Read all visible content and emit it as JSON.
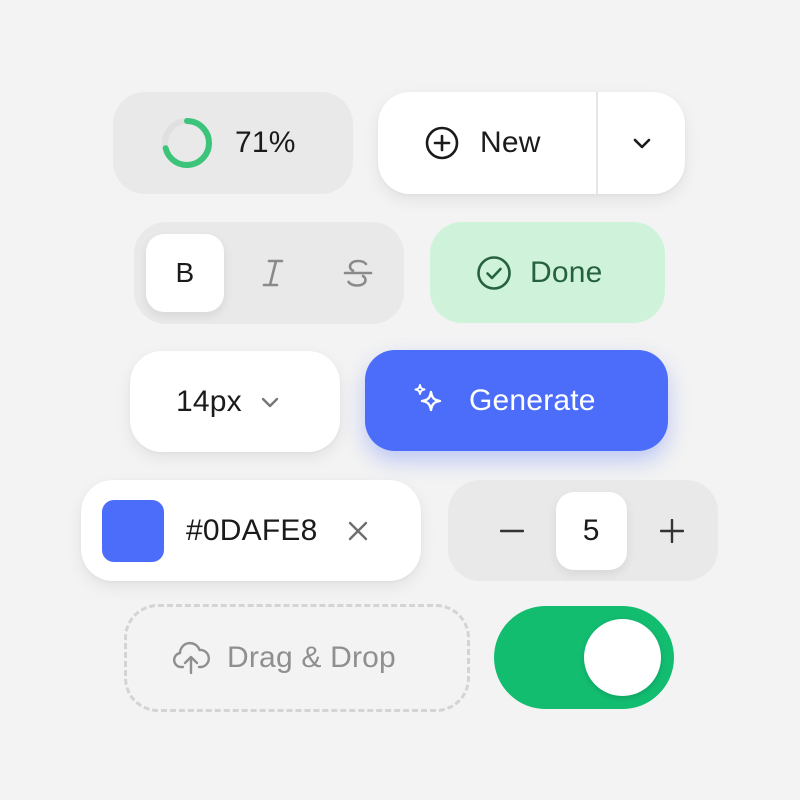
{
  "progress": {
    "value_percent": 71,
    "label": "71%",
    "track_color": "#e4e4e4",
    "fill_color": "#3cc57a"
  },
  "new_button": {
    "label": "New",
    "icon": "plus-circle-icon",
    "dropdown_icon": "chevron-down-icon"
  },
  "format_group": {
    "buttons": [
      {
        "label": "B",
        "icon": "bold-icon",
        "active": true
      },
      {
        "label": "I",
        "icon": "italic-icon",
        "active": false
      },
      {
        "label": "S",
        "icon": "strikethrough-icon",
        "active": false
      }
    ]
  },
  "done_button": {
    "label": "Done",
    "icon": "check-circle-icon",
    "bg_color": "#cff3da",
    "text_color": "#27623f"
  },
  "font_size_select": {
    "value": "14px",
    "icon": "chevron-down-icon"
  },
  "generate_button": {
    "label": "Generate",
    "icon": "sparkles-icon",
    "bg_color": "#4b6df9"
  },
  "color_field": {
    "value": "#0DAFE8",
    "swatch_color": "#4b6df9",
    "clear_icon": "close-icon"
  },
  "stepper": {
    "value": "5",
    "decrement_label": "−",
    "increment_label": "+"
  },
  "drop_zone": {
    "label": "Drag & Drop",
    "icon": "cloud-upload-icon"
  },
  "toggle": {
    "on": true,
    "on_color": "#12bd70"
  }
}
